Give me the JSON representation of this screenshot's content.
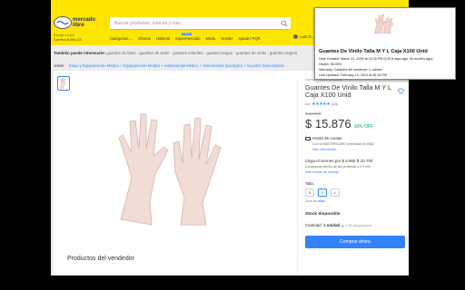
{
  "header": {
    "logo_text": "mercado\nlibre",
    "search_placeholder": "Buscar productos, marcas y más...",
    "shipto_label": "Enviar a Luis",
    "shipto_address": "Carrera 8 #5e-23",
    "nav": [
      "Categorías ⌄",
      "Ofertas",
      "Historial",
      "Supermercado",
      "Moda",
      "Vender",
      "Ayuda / PQR"
    ],
    "nav_new_badge": "NUEVO",
    "user": "Luis D..."
  },
  "interest": {
    "label": "También puede interesarte:",
    "items": "guantes de latex - guantes de vinilo - guantes esteriles - guantes largos - guantes de vinilo - guantes negros"
  },
  "breadcrumb": {
    "back": "Volver",
    "path": "Salud y Equipamiento Médico > Equipamiento Médico > Instrumental Médico > Instrumental Quirúrgico > Guantes Desechables"
  },
  "product": {
    "condition": "Nuevo | +1000 vendidos",
    "title": "Guantes De Vinilo Talla M Y L Caja X100 Unid",
    "rating": "4.6",
    "stars": "★★★★★",
    "reviews": "(23)",
    "old_price": "$ 18.900",
    "price": "$ 15.876",
    "discount": "16% OFF",
    "installments": "Hasta 36 cuotas",
    "installments_sub": "Con tu MASTERCARD terminada en 0062",
    "installments_link": "Más información",
    "arrival": "Llega el viernes por",
    "arrival_price": "$ 8.905 $ 10.700",
    "arrival_sub": "Comprando dentro de las próximas 4 h 9 min",
    "arrival_link": "Más formas de entrega",
    "size_label": "Talla:",
    "sizes": [
      "S",
      "M",
      "L"
    ],
    "size_guide": "Guía de tallas",
    "stock": "Stock disponible",
    "qty_label": "Cantidad:",
    "qty_value": "1 unidad ⌄",
    "qty_avail": "(+50 disponibles)",
    "buy_label": "Comprar ahora"
  },
  "seller_section_title": "Productos del vendedor",
  "tooltip": {
    "title": "Guantes De Vinilo Talla M Y L Caja X100 Unid",
    "lines": [
      "Date Created: March 31, 2025 at 10:30 PM (143.8 days ago, 4k months ago)",
      "Health: 98.00%",
      "Warranty: Garantía del vendedor: 1 meses",
      "Last Updated: February 13, 2024 at 06:34 PM"
    ]
  },
  "colors": {
    "header": "#ffe600",
    "accent": "#3483fa",
    "green": "#00a650"
  }
}
